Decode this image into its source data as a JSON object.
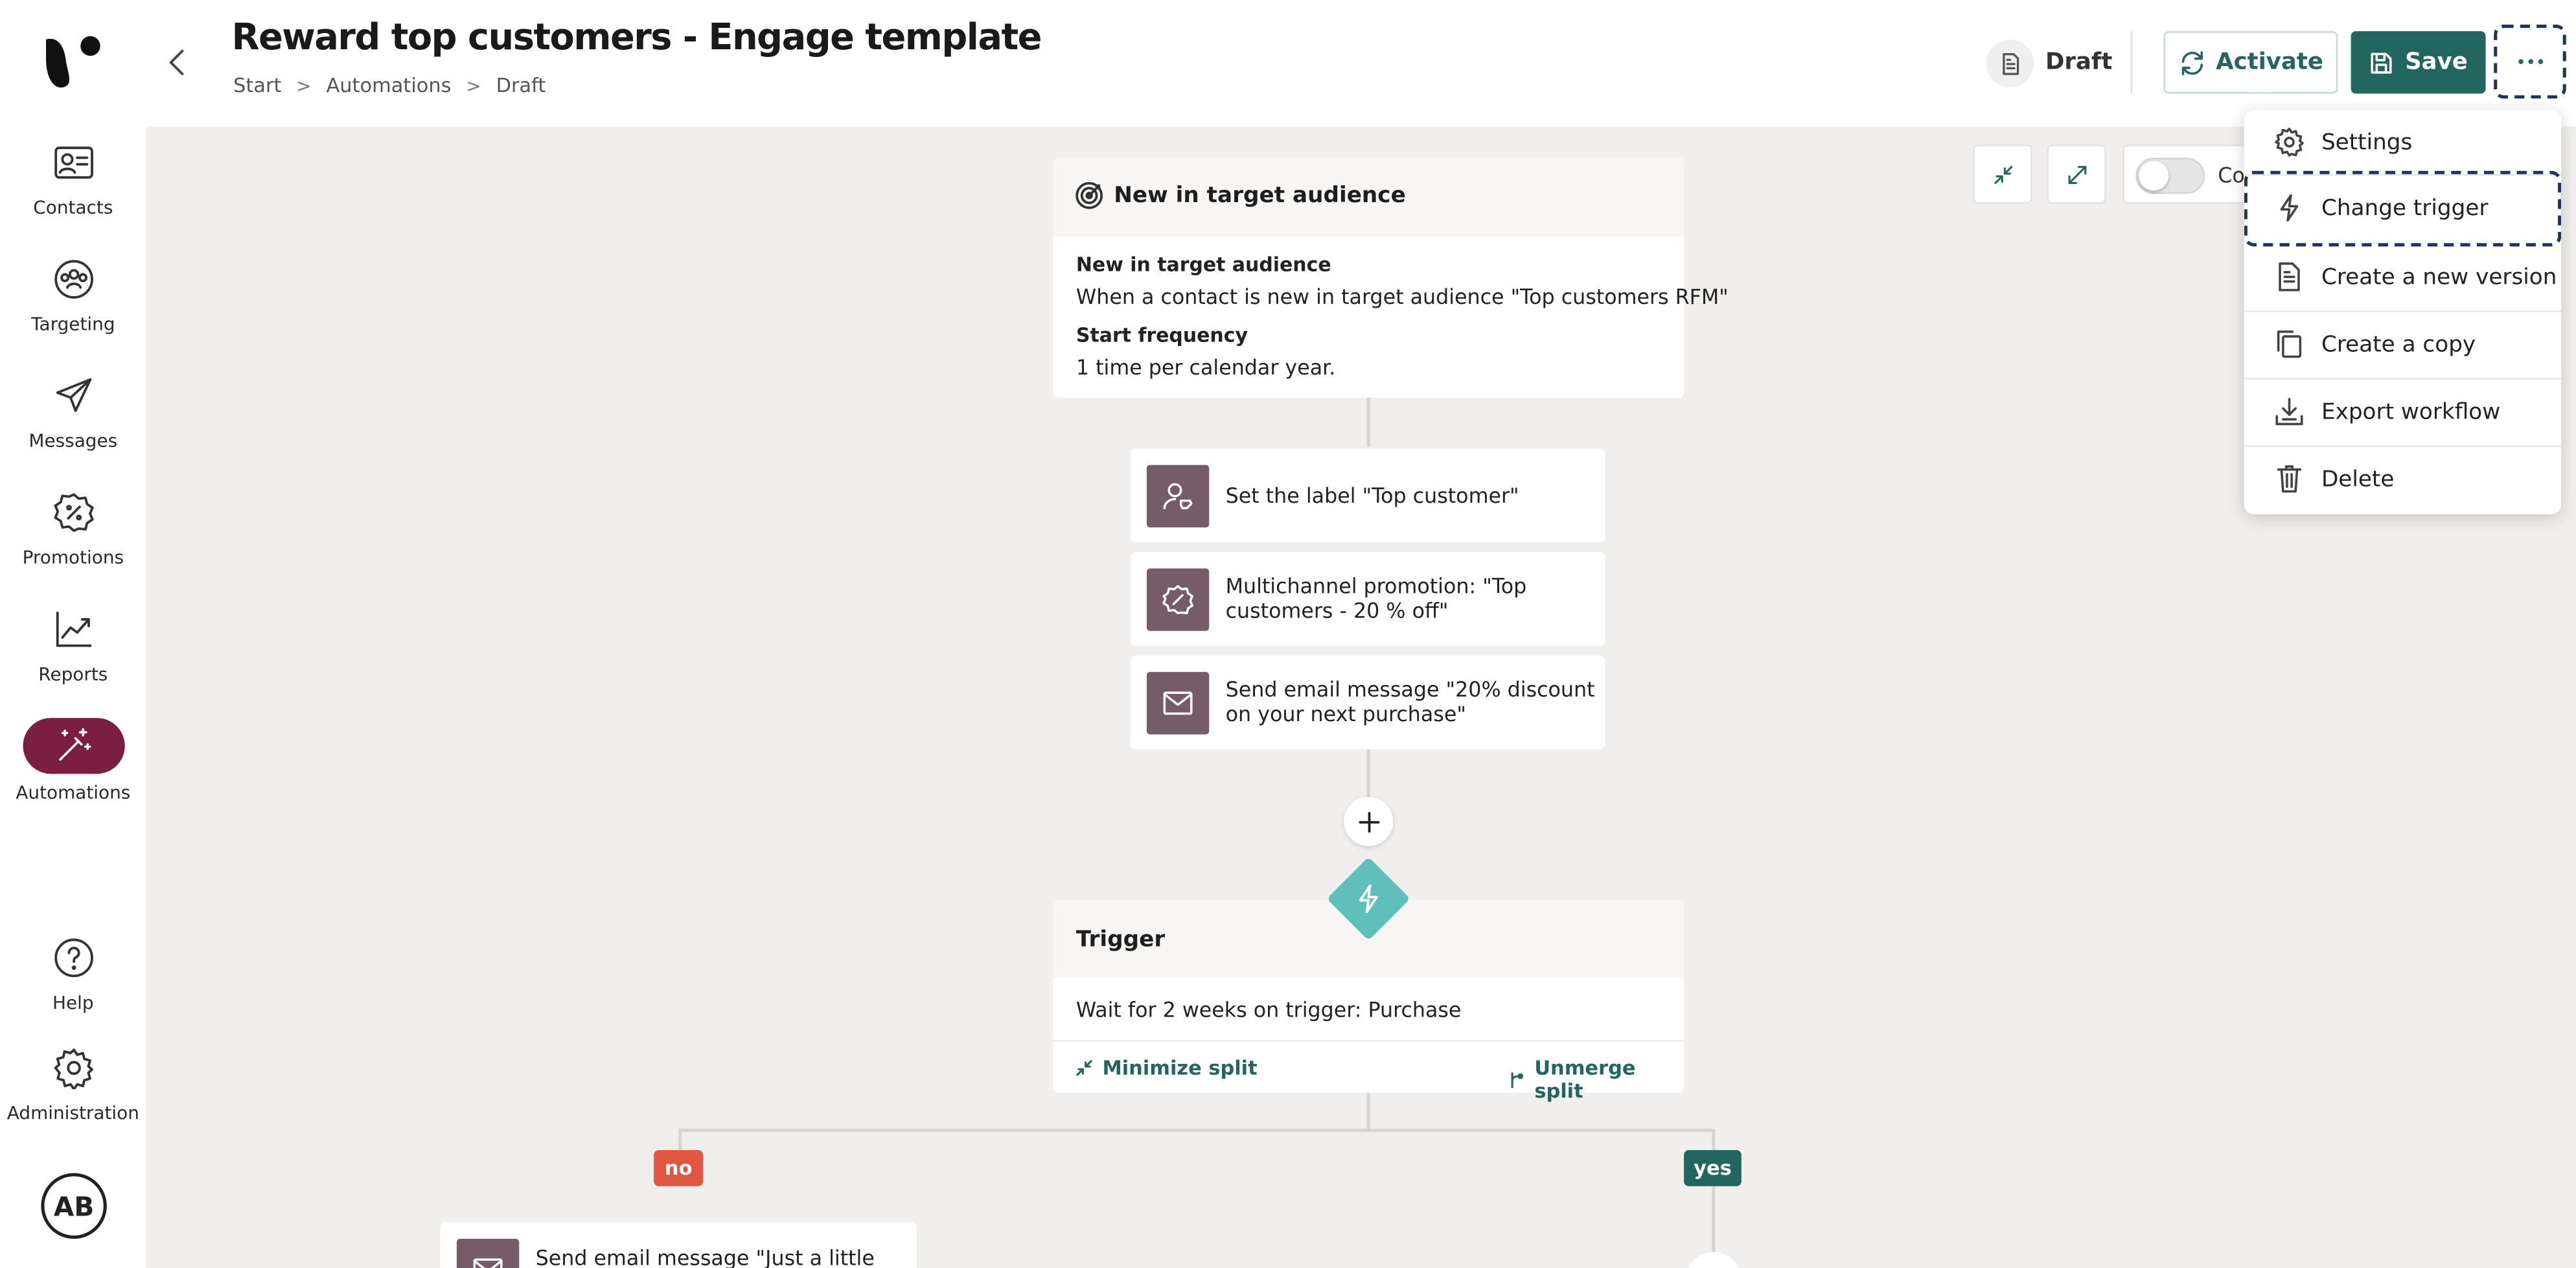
{
  "header": {
    "title": "Reward top customers - Engage template",
    "breadcrumb": [
      "Start",
      "Automations",
      "Draft"
    ],
    "status": "Draft",
    "activate_label": "Activate",
    "save_label": "Save"
  },
  "sidebar": {
    "items": [
      {
        "label": "Contacts",
        "icon": "contact-card-icon"
      },
      {
        "label": "Targeting",
        "icon": "audience-icon"
      },
      {
        "label": "Messages",
        "icon": "paper-plane-icon"
      },
      {
        "label": "Promotions",
        "icon": "percent-badge-icon"
      },
      {
        "label": "Reports",
        "icon": "trend-chart-icon"
      },
      {
        "label": "Automations",
        "icon": "magic-wand-icon",
        "active": true
      }
    ],
    "bottom": [
      {
        "label": "Help",
        "icon": "help-circle-icon"
      },
      {
        "label": "Administration",
        "icon": "gear-icon"
      }
    ],
    "avatar": "AB"
  },
  "canvas_toolbar": {
    "toggle_label": "Co"
  },
  "flow": {
    "start": {
      "header": "New in target audience",
      "condition_title": "New in target audience",
      "condition_text": "When a contact is new in target audience \"Top customers RFM\"",
      "frequency_title": "Start frequency",
      "frequency_text": "1 time per calendar year."
    },
    "actions": [
      {
        "lines": [
          "Set the label \"Top customer\""
        ],
        "icon": "user-tag-icon"
      },
      {
        "lines": [
          "Multichannel promotion: \"Top",
          "customers - 20 % off\""
        ],
        "icon": "percent-badge-icon"
      },
      {
        "lines": [
          "Send email message \"20% discount",
          "on your next purchase\""
        ],
        "icon": "envelope-icon"
      }
    ],
    "trigger": {
      "title": "Trigger",
      "text": "Wait for 2 weeks on trigger: Purchase",
      "minimize": "Minimize split",
      "unmerge": "Unmerge split"
    },
    "branch_no": "no",
    "branch_yes": "yes",
    "no_action": "Send email message \"Just a little"
  },
  "menu": {
    "items": [
      {
        "label": "Settings",
        "icon": "gear-icon"
      },
      {
        "label": "Change trigger",
        "icon": "lightning-icon"
      },
      {
        "label": "Create a new version",
        "icon": "document-icon"
      },
      {
        "label": "Create a copy",
        "icon": "copy-icon"
      },
      {
        "label": "Export workflow",
        "icon": "download-icon"
      },
      {
        "label": "Delete",
        "icon": "trash-icon"
      }
    ]
  },
  "colors": {
    "brand_green": "#23655f",
    "active_nav": "#7a1f42",
    "action_icon_bg": "#755c68",
    "trigger_diamond": "#5fbfba",
    "no_badge": "#e0573f",
    "yes_badge": "#23655f",
    "canvas_bg": "#f0efed"
  }
}
